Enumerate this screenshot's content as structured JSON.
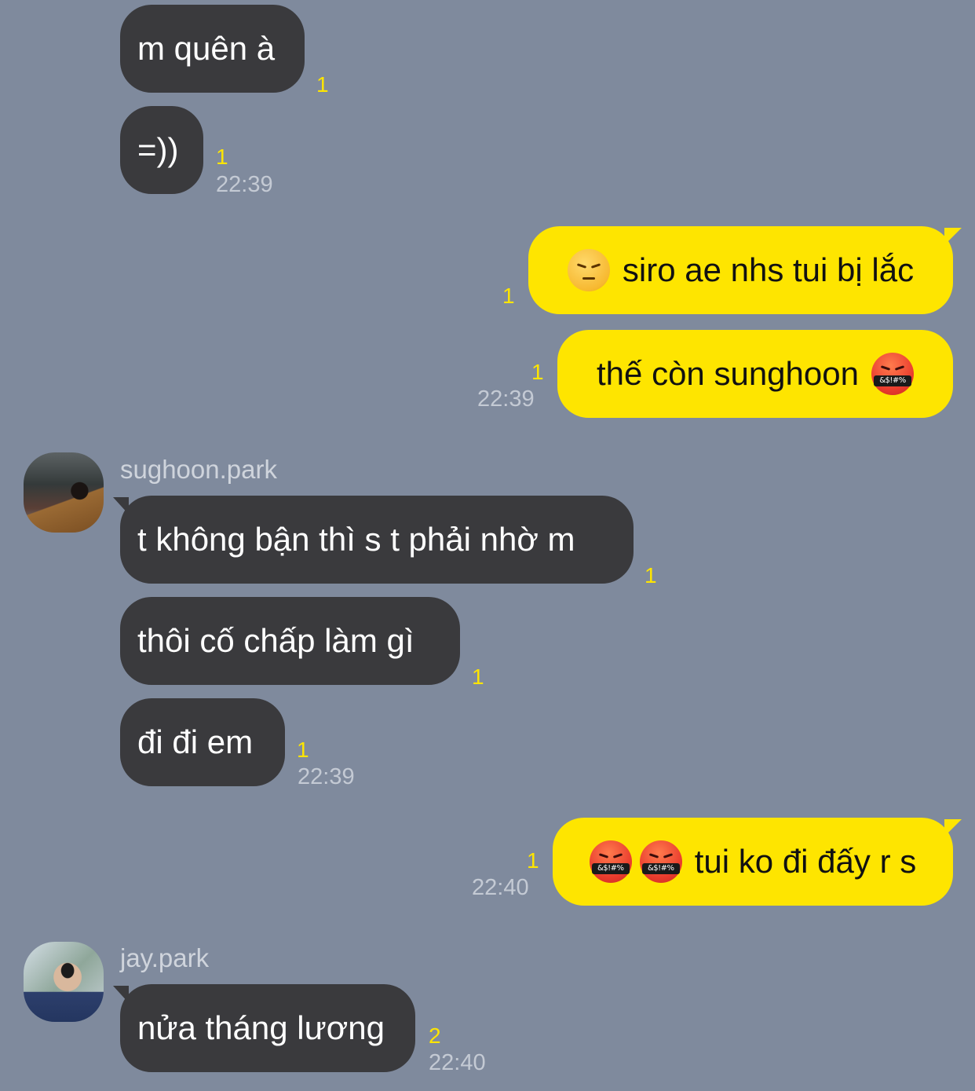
{
  "messages": [
    {
      "text": "m quên à",
      "unread": "1"
    },
    {
      "text": "=))",
      "unread": "1",
      "time": "22:39"
    },
    {
      "text": "siro ae nhs tui bị lắc",
      "emoji": "pensive-face",
      "unread": "1"
    },
    {
      "text": "thế còn sunghoon",
      "emoji": "face-with-symbols-on-mouth",
      "unread": "1",
      "time": "22:39"
    },
    {
      "sender": "sughoon.park",
      "text": "t không bận thì s t phải nhờ m",
      "unread": "1"
    },
    {
      "text": "thôi cố chấp làm gì",
      "unread": "1"
    },
    {
      "text": "đi đi em",
      "unread": "1",
      "time": "22:39"
    },
    {
      "text": "tui ko đi đấy r s",
      "emoji": "face-with-symbols-on-mouth",
      "unread": "1",
      "time": "22:40"
    },
    {
      "sender": "jay.park",
      "text": "nửa tháng lương",
      "unread": "2",
      "time": "22:40"
    }
  ],
  "emoji_text": "&$!#%",
  "colors": {
    "background": "#7f8a9d",
    "incoming_bubble": "#3a3a3d",
    "outgoing_bubble": "#fee500",
    "unread_count": "#fee500",
    "timestamp": "#c4cad4"
  }
}
